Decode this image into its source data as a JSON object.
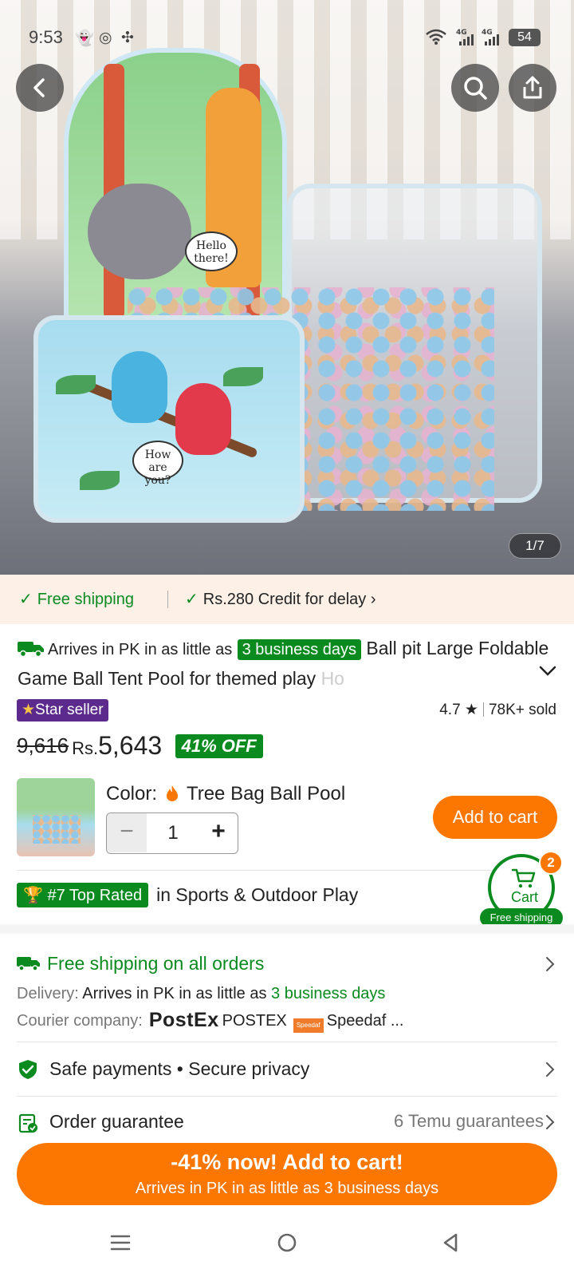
{
  "status_bar": {
    "time": "9:53",
    "battery": "54",
    "icons": [
      "snapchat-icon",
      "instagram-icon",
      "pinwheel-icon",
      "wifi-icon",
      "signal-4g-icon",
      "signal-4g-icon"
    ]
  },
  "gallery": {
    "counter": "1/7",
    "bubble_1": "Hello there!",
    "bubble_2": "How are you?"
  },
  "banner": {
    "free_shipping": "Free shipping",
    "credit": "Rs.280 Credit for delay"
  },
  "product": {
    "arrives_prefix": "Arrives in PK in as little as",
    "arrives_days": "3 business days",
    "title": "Ball pit Large Foldable Game Ball Tent Pool for themed play",
    "title_fade": "Ho",
    "star_seller": "Star seller",
    "rating": "4.7",
    "sold": "78K+ sold",
    "old_price": "9,616",
    "currency": "Rs.",
    "new_price": "5,643",
    "discount": "41% OFF",
    "color_label": "Color:",
    "color_value": "Tree Bag Ball Pool",
    "quantity": "1",
    "add_to_cart": "Add to cart"
  },
  "cart": {
    "label": "Cart",
    "badge": "2",
    "free_shipping": "Free shipping"
  },
  "ranking": {
    "pill": "#7 Top Rated",
    "category": "in Sports & Outdoor Play"
  },
  "shipping": {
    "title": "Free shipping on all orders",
    "delivery_label": "Delivery:",
    "delivery_text": "Arrives in PK in as little as",
    "delivery_days": "3 business days",
    "courier_label": "Courier company:",
    "postex_logo": "PostEx",
    "postex_name": "POSTEX",
    "speedaf_logo": "Speedaf",
    "speedaf_name": "Speedaf ..."
  },
  "safe_payments": "Safe payments • Secure privacy",
  "order_guarantee": {
    "label": "Order guarantee",
    "count": "6 Temu guarantees"
  },
  "cta": {
    "line1": "-41% now! Add to cart!",
    "line2": "Arrives in PK in as little as 3 business days"
  },
  "colors": {
    "accent_orange": "#fb7701",
    "green": "#0a8a1f",
    "star_seller_purple": "#5c2a8c",
    "banner_bg": "#fdf1e7"
  }
}
